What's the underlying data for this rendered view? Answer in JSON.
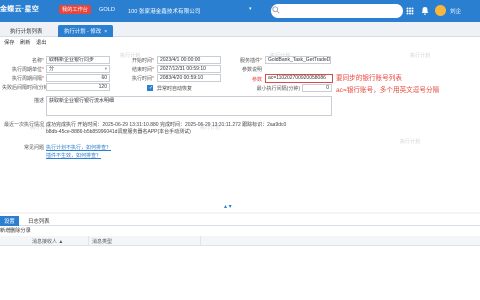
{
  "app": {
    "logo": "金蝶云·星空",
    "env_badge": "我的工作台",
    "product": "GOLD",
    "company": "100 张家港金鑫技术有限公司",
    "user": "刘企"
  },
  "tabs": [
    {
      "label": "执行计划列表"
    },
    {
      "label": "执行计划 - 修改",
      "close": "×"
    }
  ],
  "toolbar": {
    "save": "保存",
    "refresh": "刷新",
    "exit": "退出"
  },
  "form": {
    "name_label": "名称",
    "name_value": "取韩新企业银行同步",
    "exec_cycle_label": "执行周期单位",
    "exec_cycle_value": "分",
    "exec_interval_label": "执行周期间隔",
    "exec_interval_value": "60",
    "retry_label": "失败后间隔时间(分钟)",
    "retry_value": "120",
    "desc_label": "描述",
    "desc_value": "获取新企业银行银行流水明细",
    "start_label": "开始时间",
    "start_value": "2023/4/1 00:00:00",
    "end_label": "结束时间",
    "end_value": "2027/12/31 00:59:10",
    "exec_time_label": "执行时间",
    "exec_time_value": "2083/4/20 00:59:10",
    "service_label": "服务插件",
    "service_value": "GoldBank_Task_GetTradeDetail",
    "params_note_label": "参数说明",
    "params_label": "参数",
    "params_value": "ac=110202700920058086",
    "disable_label": "异常时自动恢复",
    "min_interval_label": "最小执行间隔(分钟)",
    "min_interval_value": "0",
    "last_exec_label": "最近一次执行情况",
    "last_exec_line1": "成功完成执行 开始时间：2025-06-29 13:31:10.880 完成时间：2025-06-29 13:31:11.272 跟踪标识：2aa9dc0",
    "last_exec_line2": "b8db-45ce-8886-b5b85996041d调度服务器名APP(本台手动测试)",
    "faq_label": "常见问题",
    "faq_link1": "执行计划不执行，如何排查？",
    "faq_link2": "插件不生效，如何排查？"
  },
  "annotation": {
    "line1": "要同步的银行账号列表",
    "line2": "ac=银行账号，多个用英文逗号分隔"
  },
  "watermark": "执行计划",
  "bottom_tabs": [
    {
      "label": "设置"
    },
    {
      "label": "日志列表"
    }
  ],
  "bottom_toolbar": {
    "add": "新增",
    "delete": "删除分录"
  },
  "grid": {
    "columns": [
      "消息接收人",
      "消息类型"
    ],
    "sort_mark": "▲"
  }
}
